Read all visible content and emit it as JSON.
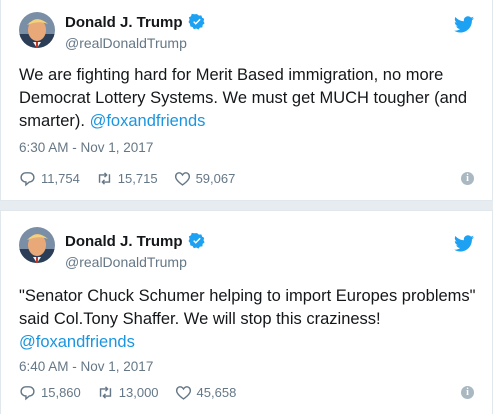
{
  "tweets": [
    {
      "name": "Donald J. Trump",
      "handle": "@realDonaldTrump",
      "text": "We are fighting hard for Merit Based immigration, no more Democrat Lottery Systems. We must get MUCH tougher (and smarter). ",
      "mention": "@foxandfriends",
      "timestamp": "6:30 AM - Nov 1, 2017",
      "replies": "11,754",
      "retweets": "15,715",
      "likes": "59,067"
    },
    {
      "name": "Donald J. Trump",
      "handle": "@realDonaldTrump",
      "text": "\"Senator Chuck Schumer helping to import Europes problems\" said Col.Tony Shaffer. We will stop this craziness! ",
      "mention": "@foxandfriends",
      "timestamp": "6:40 AM - Nov 1, 2017",
      "replies": "15,860",
      "retweets": "13,000",
      "likes": "45,658"
    }
  ],
  "icons": {
    "verified": "verified-badge-icon",
    "bird": "twitter-bird-icon",
    "reply": "reply-icon",
    "retweet": "retweet-icon",
    "like": "heart-icon",
    "info": "info-icon"
  },
  "colors": {
    "accent": "#1da1f2",
    "link": "#1b95e0",
    "muted": "#657786"
  }
}
